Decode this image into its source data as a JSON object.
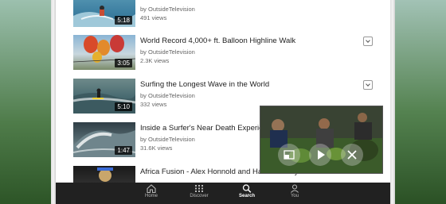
{
  "videos": [
    {
      "title": "",
      "channel": "by OutsideTelevision",
      "views": "491 views",
      "duration": "5:18"
    },
    {
      "title": "World Record 4,000+ ft. Balloon Highline Walk",
      "channel": "by OutsideTelevision",
      "views": "2.3K views",
      "duration": "3:05"
    },
    {
      "title": "Surfing the Longest Wave in the World",
      "channel": "by OutsideTelevision",
      "views": "332 views",
      "duration": "5:10"
    },
    {
      "title": "Inside a Surfer's Near Death Experience",
      "channel": "by OutsideTelevision",
      "views": "31.6K views",
      "duration": "1:47"
    },
    {
      "title": "Africa Fusion - Alex Honnold and Hazel Findlay - Official Trailer",
      "channel": "",
      "views": "",
      "duration": ""
    }
  ],
  "nav": {
    "home": "Home",
    "discover": "Discover",
    "search": "Search",
    "you": "You"
  },
  "icons": {
    "home": "home-icon",
    "discover": "grid-icon",
    "search": "search-icon",
    "you": "person-icon",
    "expand": "expand-icon",
    "play": "play-icon",
    "close": "close-icon"
  },
  "colors": {
    "navbar": "#212121",
    "active_nav": "#ffffff",
    "inactive_nav": "#b8b8b8"
  }
}
